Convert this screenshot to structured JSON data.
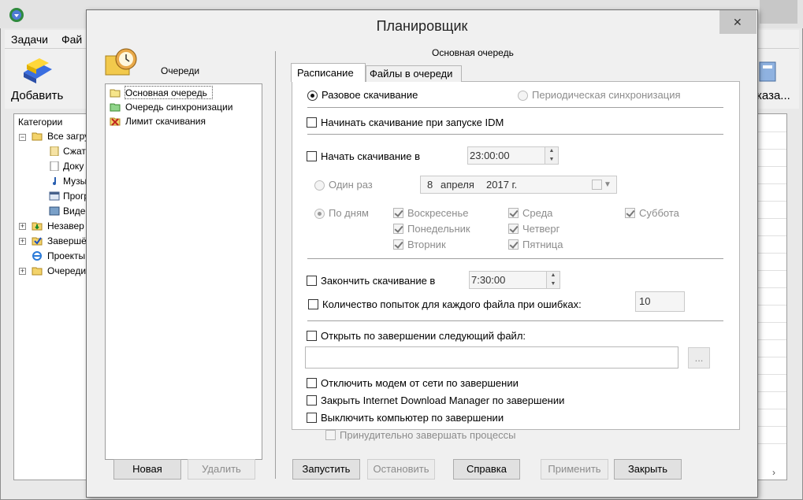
{
  "background_app": {
    "menu": [
      "Задачи",
      "Фай"
    ],
    "toolbar_add_label": "Добавить",
    "toolbar_right_label": "каза...",
    "categories_header": "Категории",
    "tree": [
      {
        "label": "Все загру",
        "icon": "folder-open-icon"
      },
      {
        "label": "Сжат",
        "icon": "archive-icon"
      },
      {
        "label": "Доку",
        "icon": "document-icon"
      },
      {
        "label": "Музы",
        "icon": "music-icon"
      },
      {
        "label": "Прогр",
        "icon": "program-icon"
      },
      {
        "label": "Видео",
        "icon": "video-icon"
      },
      {
        "label": "Незавер",
        "icon": "unfinished-icon"
      },
      {
        "label": "Завершё",
        "icon": "finished-icon"
      },
      {
        "label": "Проекты",
        "icon": "ie-icon"
      },
      {
        "label": "Очереди",
        "icon": "queues-icon"
      }
    ]
  },
  "dialog": {
    "title": "Планировщик",
    "close_glyph": "✕",
    "queues_label": "Очереди",
    "queues": [
      {
        "label": "Основная очередь",
        "icon": "queue-folder-icon"
      },
      {
        "label": "Очередь синхронизации",
        "icon": "sync-folder-icon"
      },
      {
        "label": "Лимит скачивания",
        "icon": "limit-icon"
      }
    ],
    "new_button": "Новая",
    "delete_button": "Удалить",
    "selected_queue_title": "Основная очередь",
    "tabs": [
      "Расписание",
      "Файлы в очереди"
    ],
    "schedule": {
      "one_time_download": "Разовое скачивание",
      "periodic_sync": "Периодическая синхронизация",
      "start_on_idm_startup": "Начинать скачивание при запуске IDM",
      "start_download_at": "Начать скачивание в",
      "start_time": "23:00:00",
      "once": "Один раз",
      "date_day": "8",
      "date_month": "апреля",
      "date_year": "2017 г.",
      "by_days": "По дням",
      "days": [
        {
          "label": "Воскресенье",
          "checked": true
        },
        {
          "label": "Понедельник",
          "checked": true
        },
        {
          "label": "Вторник",
          "checked": true
        },
        {
          "label": "Среда",
          "checked": true
        },
        {
          "label": "Четверг",
          "checked": true
        },
        {
          "label": "Пятница",
          "checked": true
        },
        {
          "label": "Суббота",
          "checked": true
        }
      ],
      "stop_download_at": "Закончить скачивание в",
      "stop_time": "7:30:00",
      "retry_attempts_label": "Количество попыток для каждого файла при ошибках:",
      "retry_attempts_value": "10",
      "open_file_on_completion": "Открыть по завершении следующий файл:",
      "file_path": "",
      "browse_button": "...",
      "hang_up_modem": "Отключить модем от сети по завершении",
      "exit_idm": "Закрыть Internet Download Manager по завершении",
      "shutdown_pc": "Выключить компьютер по завершении",
      "force_terminate": "Принудительно завершать процессы"
    },
    "buttons": {
      "start": "Запустить",
      "stop": "Остановить",
      "help": "Справка",
      "apply": "Применить",
      "close": "Закрыть"
    }
  }
}
